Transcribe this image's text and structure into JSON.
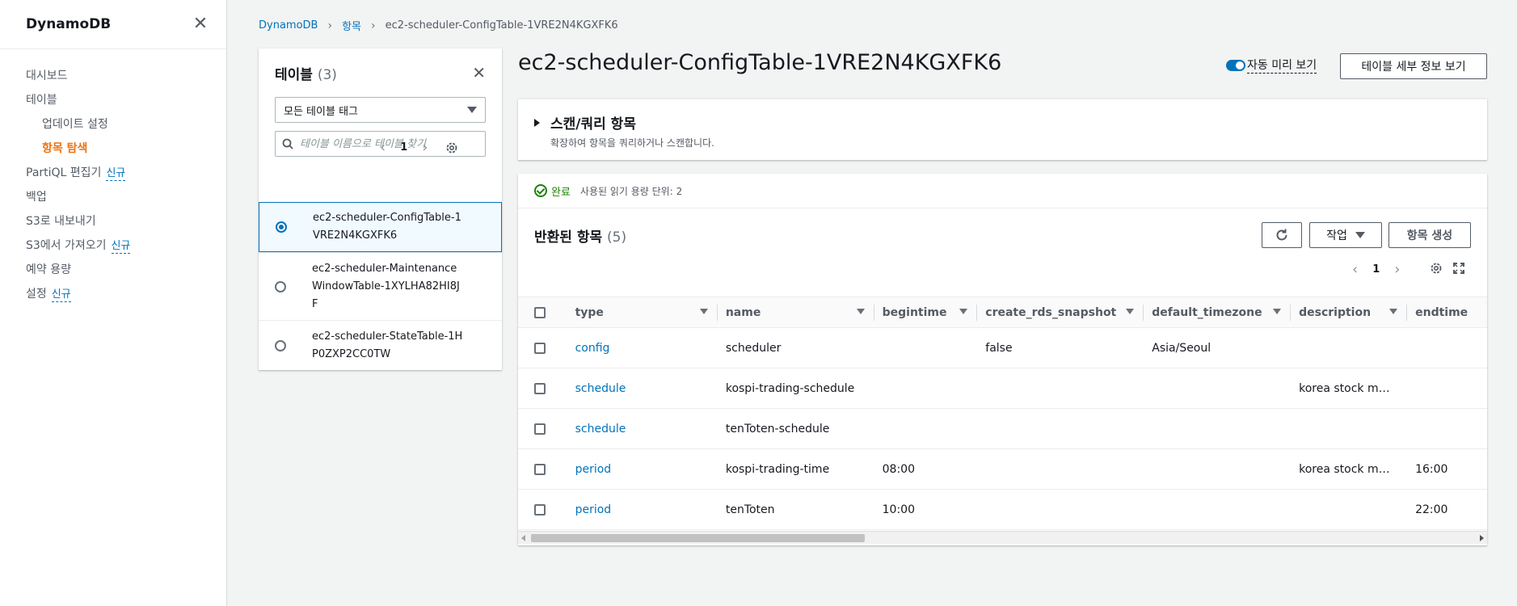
{
  "sidebar": {
    "title": "DynamoDB",
    "items": [
      {
        "label": "대시보드",
        "badge": ""
      },
      {
        "label": "테이블",
        "badge": ""
      },
      {
        "label": "업데이트 설정",
        "badge": ""
      },
      {
        "label": "항목 탐색",
        "badge": ""
      },
      {
        "label": "PartiQL 편집기",
        "badge": "신규"
      },
      {
        "label": "백업",
        "badge": ""
      },
      {
        "label": "S3로 내보내기",
        "badge": ""
      },
      {
        "label": "S3에서 가져오기",
        "badge": "신규"
      },
      {
        "label": "예약 용량",
        "badge": ""
      },
      {
        "label": "설정",
        "badge": "신규"
      }
    ]
  },
  "breadcrumb": {
    "root": "DynamoDB",
    "section": "항목",
    "current": "ec2-scheduler-ConfigTable-1VRE2N4KGXFK6"
  },
  "tables_panel": {
    "title": "테이블",
    "count": "(3)",
    "tag_filter": "모든 테이블 태그",
    "search_placeholder": "테이블 이름으로 테이블 찾기",
    "page": "1",
    "tables": [
      {
        "name": "ec2-scheduler-ConfigTable-1VRE2N4KGXFK6"
      },
      {
        "name": "ec2-scheduler-MaintenanceWindowTable-1XYLHA82HI8JF"
      },
      {
        "name": "ec2-scheduler-StateTable-1HP0ZXP2CC0TW"
      }
    ]
  },
  "main": {
    "title": "ec2-scheduler-ConfigTable-1VRE2N4KGXFK6",
    "auto_preview_label": "자동 미리 보기",
    "details_button": "테이블 세부 정보 보기"
  },
  "scan": {
    "title": "스캔/쿼리 항목",
    "subtitle": "확장하여 항목을 쿼리하거나 스캔합니다."
  },
  "results": {
    "status": "완료",
    "rcu": "사용된 읽기 용량 단위: 2",
    "title": "반환된 항목",
    "count": "(5)",
    "action_button": "작업",
    "create_button": "항목 생성",
    "page": "1",
    "columns": [
      "type",
      "name",
      "begintime",
      "create_rds_snapshot",
      "default_timezone",
      "description",
      "endtime"
    ],
    "rows": [
      [
        "config",
        "scheduler",
        "",
        "false",
        "Asia/Seoul",
        "",
        ""
      ],
      [
        "schedule",
        "kospi-trading-schedule",
        "",
        "",
        "",
        "korea stock m…",
        ""
      ],
      [
        "schedule",
        "tenToten-schedule",
        "",
        "",
        "",
        "",
        ""
      ],
      [
        "period",
        "kospi-trading-time",
        "08:00",
        "",
        "",
        "korea stock m…",
        "16:00"
      ],
      [
        "period",
        "tenToten",
        "10:00",
        "",
        "",
        "",
        "22:00"
      ]
    ]
  },
  "colors": {
    "link": "#0073bb",
    "active_nav": "#ec7211",
    "success": "#1d8102"
  }
}
